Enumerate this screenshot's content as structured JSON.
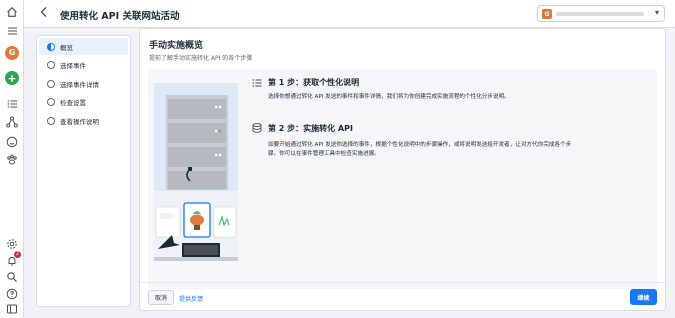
{
  "header": {
    "title": "使用转化 API 关联网站活动",
    "account_badge": "G"
  },
  "rail": {
    "avatar_letter": "G",
    "notification_count": "2"
  },
  "steps": [
    {
      "label": "概览",
      "active": true
    },
    {
      "label": "选择事件",
      "active": false
    },
    {
      "label": "选择事件详情",
      "active": false
    },
    {
      "label": "检查设置",
      "active": false
    },
    {
      "label": "查看操作说明",
      "active": false
    }
  ],
  "main": {
    "title": "手动实施概览",
    "subtitle": "提前了解手动实施转化 API 的各个步骤",
    "step1": {
      "title": "第 1 步：获取个性化说明",
      "text": "选择你想通过转化 API 发送的事件和事件详情，我们将为你创建完成实施流程的个性化分步说明。",
      "icon": "list-icon"
    },
    "step2": {
      "title": "第 2 步：实施转化 API",
      "text": "如要开始通过转化 API 发送你选择的事件，根据个性化说明中的步骤操作，或将说明发送给开发者，让对方代你完成各个步骤。你可以在事件管理工具中检查实施进展。",
      "icon": "database-icon"
    }
  },
  "footer": {
    "cancel_label": "取消",
    "feedback_label": "提供反馈",
    "continue_label": "继续"
  },
  "colors": {
    "accent": "#1877f2",
    "avatar": "#e07a3f",
    "add": "#31a24c"
  }
}
